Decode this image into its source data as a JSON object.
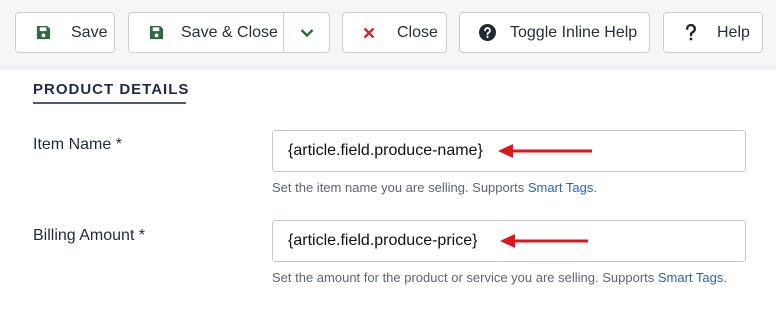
{
  "toolbar": {
    "save_label": "Save",
    "save_close_label": "Save & Close",
    "close_label": "Close",
    "toggle_help_label": "Toggle Inline Help",
    "help_label": "Help"
  },
  "section": {
    "title": "PRODUCT DETAILS"
  },
  "fields": {
    "item_name": {
      "label": "Item Name *",
      "value": "{article.field.produce-name}",
      "help_text": "Set the item name you are selling. Supports ",
      "help_link": "Smart Tags",
      "help_suffix": "."
    },
    "billing_amount": {
      "label": "Billing Amount *",
      "value": "{article.field.produce-price}",
      "help_text": "Set the amount for the product or service you are selling. Supports ",
      "help_link": "Smart Tags",
      "help_suffix": "."
    }
  },
  "colors": {
    "save_icon": "#2f6b3f",
    "close_icon": "#d0262d",
    "annotation_arrow": "#e0151b",
    "link": "#2a63b8"
  },
  "icons": {
    "save": "floppy-disk-icon",
    "dropdown": "chevron-down-icon",
    "close": "x-icon",
    "toggle_help": "question-circle-icon",
    "help": "question-mark-icon"
  }
}
